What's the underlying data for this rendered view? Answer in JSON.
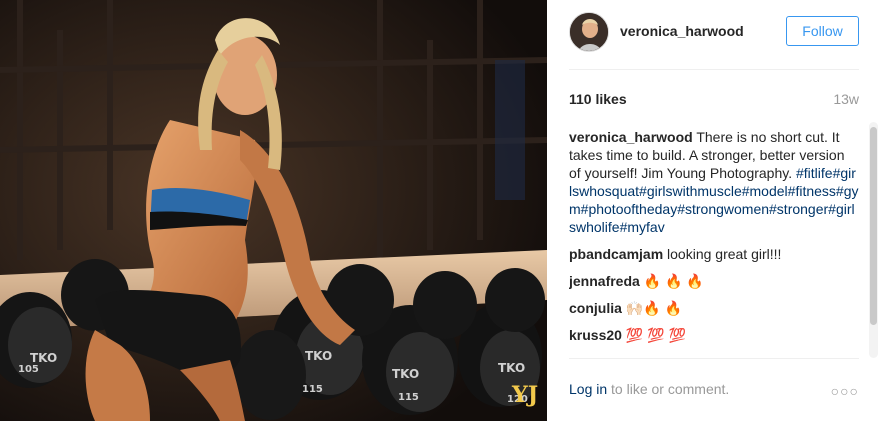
{
  "post": {
    "username": "veronica_harwood",
    "follow_label": "Follow",
    "likes": "110 likes",
    "age": "13w"
  },
  "caption": {
    "username": "veronica_harwood",
    "text": "There is no short cut. It takes time to build. A stronger, better version of yourself! Jim Young Photography.",
    "hashtags": "#fitlife#girlswhosquat#girlswithmuscle#model#fitness#gym#photooftheday#strongwomen#stronger#girlswholife#myfav"
  },
  "comments": [
    {
      "user": "pbandcamjam",
      "text": "looking great girl!!!"
    },
    {
      "user": "jennafreda",
      "text": "🔥 🔥 🔥"
    },
    {
      "user": "conjulia",
      "text": "🙌🏻🔥 🔥"
    },
    {
      "user": "kruss20",
      "text": "💯 💯 💯"
    }
  ],
  "footer": {
    "login_label": "Log in",
    "rest": "to like or comment.",
    "more": "○○○"
  },
  "photo": {
    "watermark": "YJ",
    "plate_labels": [
      "TKO",
      "TKO",
      "TKO",
      "TKO",
      "115",
      "115",
      "120",
      "105"
    ]
  },
  "colors": {
    "accent": "#3897f0",
    "link": "#003569",
    "muted": "#999999"
  }
}
